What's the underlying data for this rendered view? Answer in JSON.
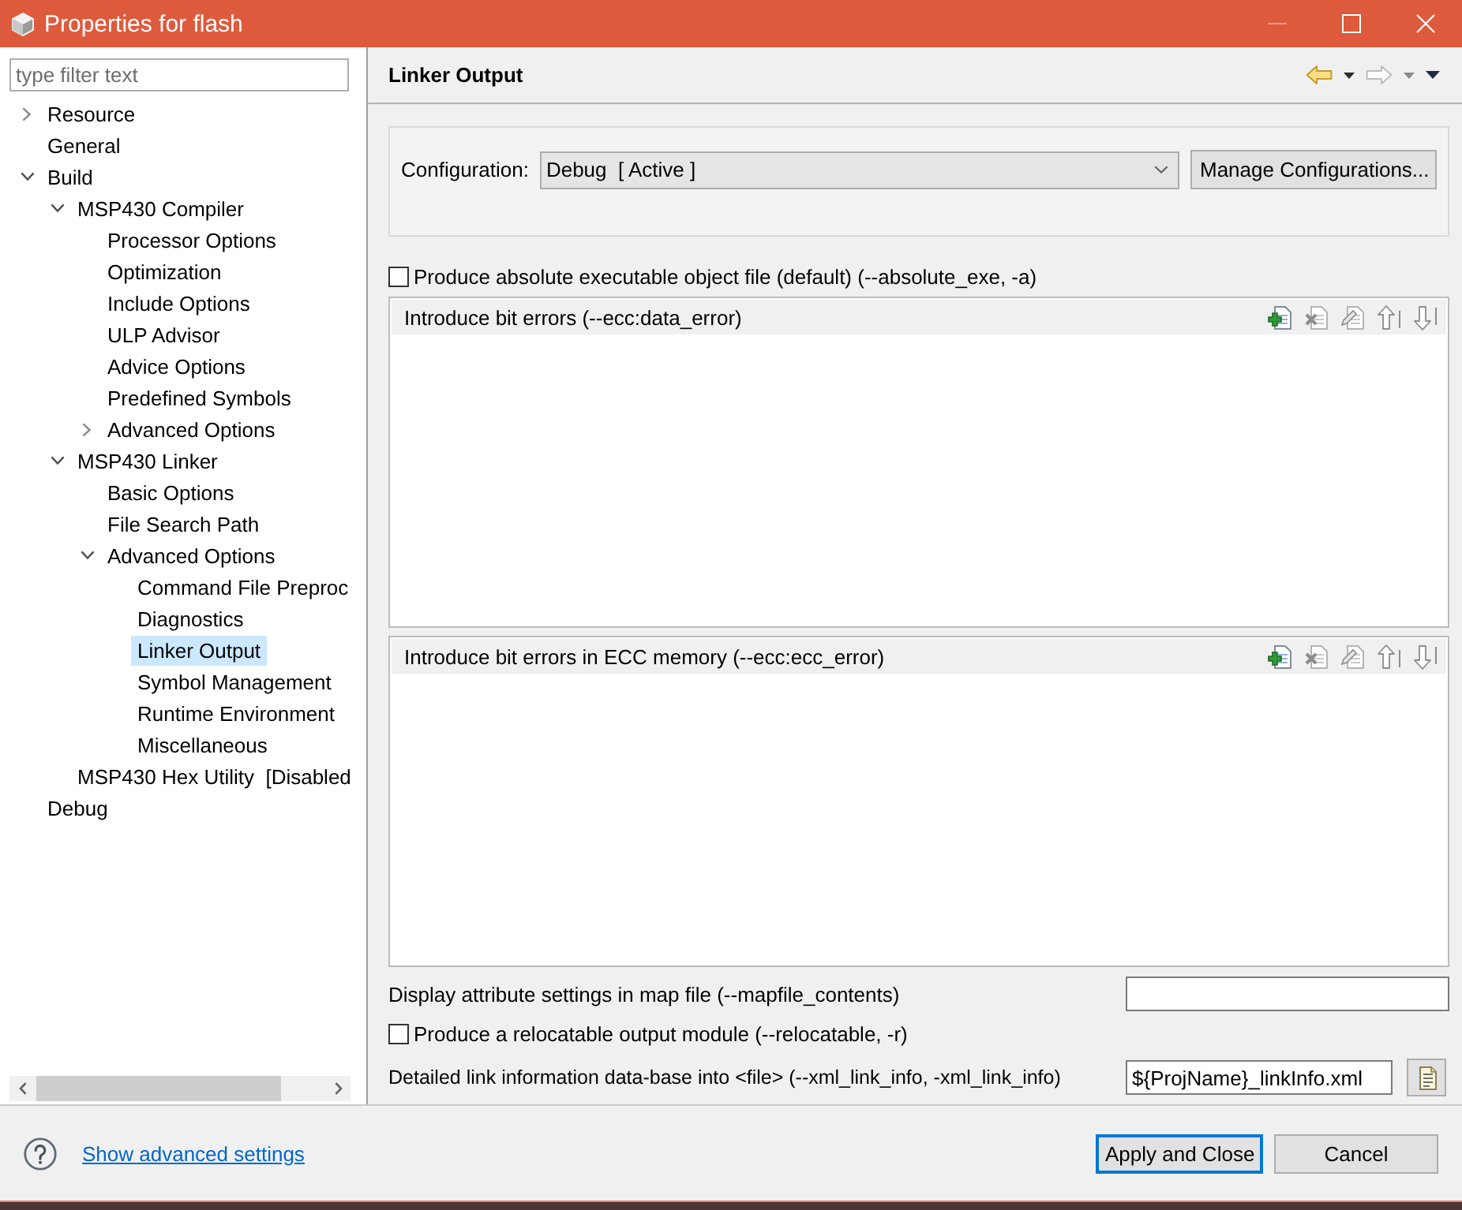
{
  "window": {
    "title": "Properties for flash",
    "controls": [
      {
        "kind": "minimize",
        "disabled": true
      },
      {
        "kind": "maximize",
        "disabled": false
      },
      {
        "kind": "close",
        "disabled": false
      }
    ]
  },
  "sidebar": {
    "filter": {
      "placeholder": "type filter text"
    },
    "tree": [
      {
        "label": "Resource",
        "expanded": false,
        "selected": false
      },
      {
        "label": "General",
        "selected": false
      },
      {
        "label": "Build",
        "expanded": true,
        "selected": false,
        "children": [
          {
            "label": "MSP430 Compiler",
            "expanded": true,
            "selected": false,
            "children": [
              {
                "label": "Processor Options",
                "selected": false
              },
              {
                "label": "Optimization",
                "selected": false
              },
              {
                "label": "Include Options",
                "selected": false
              },
              {
                "label": "ULP Advisor",
                "selected": false
              },
              {
                "label": "Advice Options",
                "selected": false
              },
              {
                "label": "Predefined Symbols",
                "selected": false
              },
              {
                "label": "Advanced Options",
                "expanded": false,
                "selected": false
              }
            ]
          },
          {
            "label": "MSP430 Linker",
            "expanded": true,
            "selected": false,
            "children": [
              {
                "label": "Basic Options",
                "selected": false
              },
              {
                "label": "File Search Path",
                "selected": false
              },
              {
                "label": "Advanced Options",
                "expanded": true,
                "selected": false,
                "children": [
                  {
                    "label": "Command File Preproc",
                    "selected": false
                  },
                  {
                    "label": "Diagnostics",
                    "selected": false
                  },
                  {
                    "label": "Linker Output",
                    "selected": true
                  },
                  {
                    "label": "Symbol Management",
                    "selected": false
                  },
                  {
                    "label": "Runtime Environment",
                    "selected": false
                  },
                  {
                    "label": "Miscellaneous",
                    "selected": false
                  }
                ]
              }
            ]
          },
          {
            "label": "MSP430 Hex Utility  [Disabled",
            "selected": false
          }
        ]
      },
      {
        "label": "Debug",
        "selected": false
      }
    ]
  },
  "page": {
    "title": "Linker Output",
    "navigation": [
      {
        "kind": "back",
        "disabled": false
      },
      {
        "kind": "forward",
        "disabled": true
      }
    ]
  },
  "configuration": {
    "label": "Configuration:",
    "value": "Debug  [ Active ]",
    "button": "Manage Configurations..."
  },
  "options": [
    {
      "kind": "checkbox",
      "label": "Produce absolute executable object file (default) (--absolute_exe, -a)",
      "checked": false
    },
    {
      "kind": "list",
      "title": "Introduce bit errors (--ecc:data_error)",
      "tools": [
        {
          "kind": "add",
          "disabled": false
        },
        {
          "kind": "delete",
          "disabled": true
        },
        {
          "kind": "edit",
          "disabled": true
        },
        {
          "kind": "up",
          "disabled": true
        },
        {
          "kind": "down",
          "disabled": true
        }
      ]
    },
    {
      "kind": "list",
      "title": "Introduce bit errors in ECC memory (--ecc:ecc_error)",
      "tools": [
        {
          "kind": "add",
          "disabled": false
        },
        {
          "kind": "delete",
          "disabled": true
        },
        {
          "kind": "edit",
          "disabled": true
        },
        {
          "kind": "up",
          "disabled": true
        },
        {
          "kind": "down",
          "disabled": true
        }
      ]
    },
    {
      "kind": "text",
      "label": "Display attribute settings in map file (--mapfile_contents)"
    },
    {
      "kind": "checkbox",
      "label": "Produce a relocatable output module (--relocatable, -r)",
      "checked": false
    },
    {
      "kind": "file",
      "label": "Detailed link information data-base into <file> (--xml_link_info, -xml_link_info)",
      "value": "${ProjName}_linkInfo.xml"
    }
  ],
  "footer": {
    "link": "Show advanced settings",
    "buttons": [
      {
        "label": "Apply and Close",
        "default": true
      },
      {
        "label": "Cancel",
        "default": false
      }
    ]
  }
}
